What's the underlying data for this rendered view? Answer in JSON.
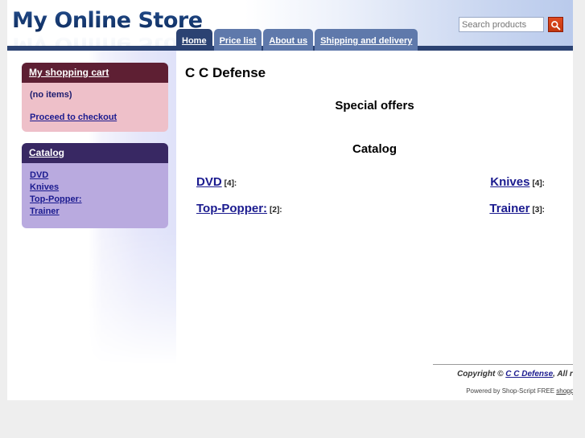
{
  "header": {
    "logo": "My Online Store",
    "search": {
      "placeholder": "Search products",
      "value": "",
      "button_icon": "search-icon"
    }
  },
  "nav": {
    "tabs": [
      {
        "label": "Home",
        "active": true
      },
      {
        "label": "Price list",
        "active": false
      },
      {
        "label": "About us",
        "active": false
      },
      {
        "label": "Shipping and delivery",
        "active": false
      }
    ]
  },
  "sidebar": {
    "cart": {
      "title": "My shopping cart",
      "empty_text": "(no items)",
      "checkout_label": "Proceed to checkout"
    },
    "catalog": {
      "title": "Catalog",
      "items": [
        {
          "label": "DVD"
        },
        {
          "label": "Knives"
        },
        {
          "label": "Top-Popper:"
        },
        {
          "label": "Trainer"
        }
      ]
    }
  },
  "main": {
    "page_title": "C C Defense",
    "special_offers_title": "Special offers",
    "catalog_title": "Catalog",
    "categories": [
      {
        "name": "DVD",
        "count": "[4]:"
      },
      {
        "name": "Knives",
        "count": "[4]:"
      },
      {
        "name": "Top-Popper:",
        "count": "[2]:"
      },
      {
        "name": "Trainer",
        "count": "[3]:"
      }
    ]
  },
  "footer": {
    "copyright_prefix": "Copyright © ",
    "copyright_link": "C C Defense",
    "copyright_suffix": ", All rights reserved.",
    "powered_prefix": "Powered by Shop-Script FREE ",
    "powered_link": "shopping cart software"
  },
  "colors": {
    "navy": "#2b4272",
    "tab_inactive": "#5f79ab",
    "cart_header": "#5e1f33",
    "cart_body": "#eec0c9",
    "catalog_header": "#382863",
    "catalog_body": "#b9aadf",
    "link": "#1b1b8f",
    "search_button": "#c2370f",
    "page_bg": "#eeeeee"
  }
}
